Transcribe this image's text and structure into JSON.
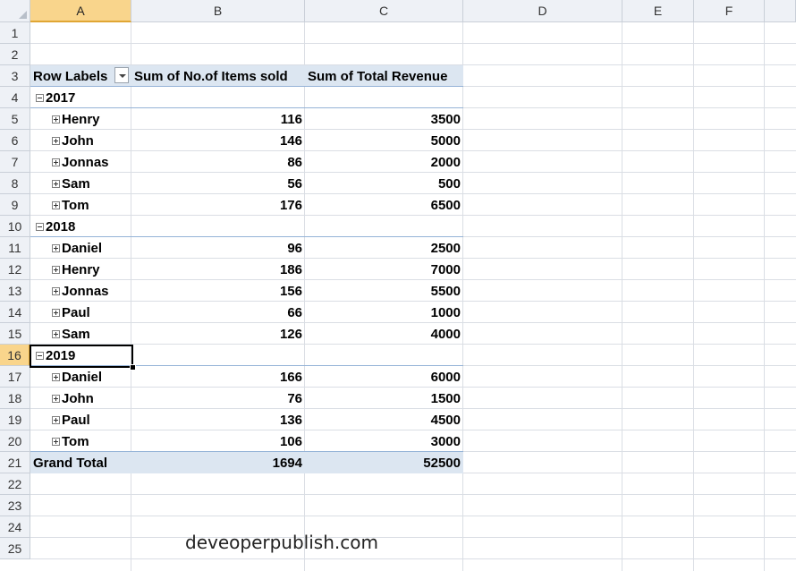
{
  "columns": [
    "A",
    "B",
    "C",
    "D",
    "E",
    "F"
  ],
  "selected_column": "A",
  "row_numbers": [
    "1",
    "2",
    "3",
    "4",
    "5",
    "6",
    "7",
    "8",
    "9",
    "10",
    "11",
    "12",
    "13",
    "14",
    "15",
    "16",
    "17",
    "18",
    "19",
    "20",
    "21",
    "22",
    "23",
    "24",
    "25"
  ],
  "selected_row": "16",
  "pivot": {
    "header": {
      "row_labels": "Row Labels",
      "items_sold": "Sum of No.of Items sold",
      "revenue": "Sum of Total Revenue"
    },
    "groups": [
      {
        "year": "2017",
        "items": [
          {
            "name": "Henry",
            "items_sold": "116",
            "revenue": "3500"
          },
          {
            "name": "John",
            "items_sold": "146",
            "revenue": "5000"
          },
          {
            "name": "Jonnas",
            "items_sold": "86",
            "revenue": "2000"
          },
          {
            "name": "Sam",
            "items_sold": "56",
            "revenue": "500"
          },
          {
            "name": "Tom",
            "items_sold": "176",
            "revenue": "6500"
          }
        ]
      },
      {
        "year": "2018",
        "items": [
          {
            "name": "Daniel",
            "items_sold": "96",
            "revenue": "2500"
          },
          {
            "name": "Henry",
            "items_sold": "186",
            "revenue": "7000"
          },
          {
            "name": "Jonnas",
            "items_sold": "156",
            "revenue": "5500"
          },
          {
            "name": "Paul",
            "items_sold": "66",
            "revenue": "1000"
          },
          {
            "name": "Sam",
            "items_sold": "126",
            "revenue": "4000"
          }
        ]
      },
      {
        "year": "2019",
        "items": [
          {
            "name": "Daniel",
            "items_sold": "166",
            "revenue": "6000"
          },
          {
            "name": "John",
            "items_sold": "76",
            "revenue": "1500"
          },
          {
            "name": "Paul",
            "items_sold": "136",
            "revenue": "4500"
          },
          {
            "name": "Tom",
            "items_sold": "106",
            "revenue": "3000"
          }
        ]
      }
    ],
    "grand_total": {
      "label": "Grand Total",
      "items_sold": "1694",
      "revenue": "52500"
    }
  },
  "watermark": "deveoperpublish.com",
  "colors": {
    "header_bg": "#eef1f6",
    "selected_header": "#f9d58c",
    "pivot_band": "#dce6f1",
    "pivot_line": "#95b3d7"
  }
}
